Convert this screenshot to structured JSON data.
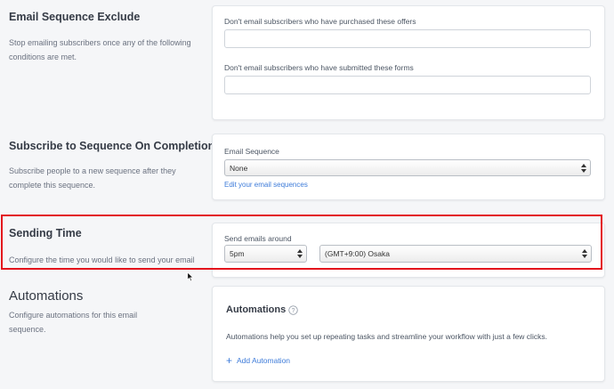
{
  "email_sequence_exclude": {
    "title": "Email Sequence Exclude",
    "description": "Stop emailing subscribers once any of the following conditions are met.",
    "offers_label": "Don't email subscribers who have purchased these offers",
    "offers_value": "",
    "forms_label": "Don't email subscribers who have submitted these forms",
    "forms_value": ""
  },
  "subscribe_on_completion": {
    "title": "Subscribe to Sequence On Completion",
    "description": "Subscribe people to a new sequence after they complete this sequence.",
    "field_label": "Email Sequence",
    "selected": "None",
    "edit_link": "Edit your email sequences"
  },
  "sending_time": {
    "title": "Sending Time",
    "description": "Configure the time you would like to send your email sequences.",
    "field_label": "Send emails around",
    "time_selected": "5pm",
    "timezone_selected": "(GMT+9:00) Osaka"
  },
  "automations": {
    "title": "Automations",
    "description": "Configure automations for this email sequence.",
    "card_title": "Automations",
    "card_text": "Automations help you set up repeating tasks and streamline your workflow with just a few clicks.",
    "add_button": "Add Automation"
  },
  "colors": {
    "accent": "#3d7bd9",
    "highlight": "#e3121c",
    "background": "#f5f6f8"
  },
  "icons": [
    "select-arrows-icon",
    "help-circle-icon",
    "plus-icon",
    "mouse-cursor-icon"
  ]
}
